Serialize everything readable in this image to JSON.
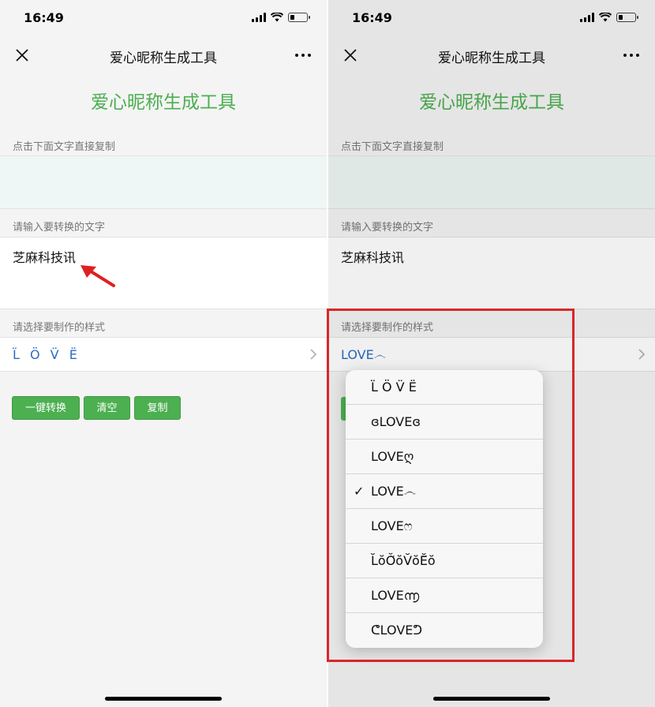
{
  "status_bar": {
    "time": "16:49"
  },
  "nav": {
    "title": "爱心昵称生成工具"
  },
  "page": {
    "heading": "爱心昵称生成工具",
    "copy_label": "点击下面文字直接复制",
    "input_label": "请输入要转换的文字",
    "input_value": "芝麻科技讯",
    "style_label": "请选择要制作的样式"
  },
  "left": {
    "style_value": "L̈ Ö V̈ Ë"
  },
  "right": {
    "style_value": "LOVE෴"
  },
  "buttons": {
    "convert": "一键转换",
    "clear": "清空",
    "copy": "复制"
  },
  "style_options": [
    {
      "label": "L̈ Ö V̈ Ë",
      "selected": false
    },
    {
      "label": "ɞLOVEɞ",
      "selected": false
    },
    {
      "label": "LOVEღ",
      "selected": false
    },
    {
      "label": "LOVE෴",
      "selected": true
    },
    {
      "label": "LOVEෆ",
      "selected": false
    },
    {
      "label": "L̆ŏŎ̆ŏV̆ŏĔ̆ŏ",
      "selected": false
    },
    {
      "label": "LOVE൬",
      "selected": false
    },
    {
      "label": "ᕦLOVEᕤ",
      "selected": false
    }
  ],
  "check_mark": "✓",
  "colors": {
    "accent_green": "#4caf50",
    "link_blue": "#2b6cc4",
    "highlight_red": "#d9262a"
  }
}
